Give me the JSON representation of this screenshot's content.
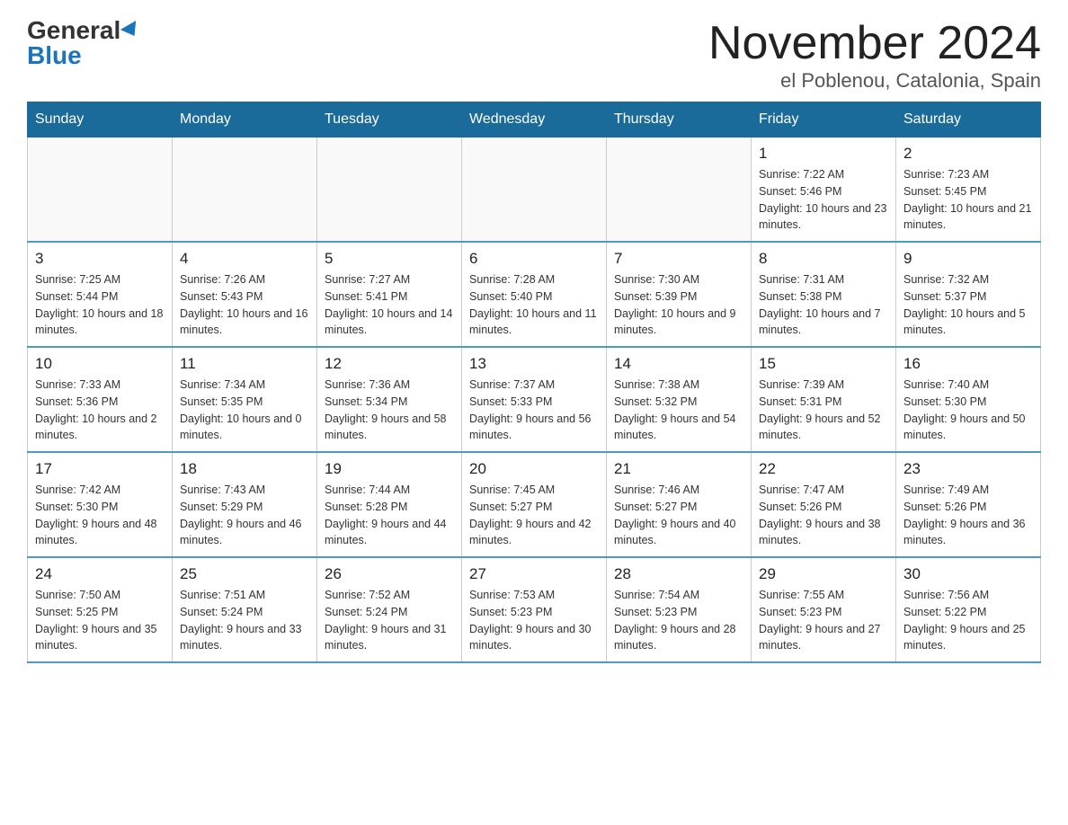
{
  "logo": {
    "general": "General",
    "blue": "Blue"
  },
  "title": "November 2024",
  "subtitle": "el Poblenou, Catalonia, Spain",
  "days_of_week": [
    "Sunday",
    "Monday",
    "Tuesday",
    "Wednesday",
    "Thursday",
    "Friday",
    "Saturday"
  ],
  "weeks": [
    [
      {
        "day": "",
        "info": ""
      },
      {
        "day": "",
        "info": ""
      },
      {
        "day": "",
        "info": ""
      },
      {
        "day": "",
        "info": ""
      },
      {
        "day": "",
        "info": ""
      },
      {
        "day": "1",
        "info": "Sunrise: 7:22 AM\nSunset: 5:46 PM\nDaylight: 10 hours and 23 minutes."
      },
      {
        "day": "2",
        "info": "Sunrise: 7:23 AM\nSunset: 5:45 PM\nDaylight: 10 hours and 21 minutes."
      }
    ],
    [
      {
        "day": "3",
        "info": "Sunrise: 7:25 AM\nSunset: 5:44 PM\nDaylight: 10 hours and 18 minutes."
      },
      {
        "day": "4",
        "info": "Sunrise: 7:26 AM\nSunset: 5:43 PM\nDaylight: 10 hours and 16 minutes."
      },
      {
        "day": "5",
        "info": "Sunrise: 7:27 AM\nSunset: 5:41 PM\nDaylight: 10 hours and 14 minutes."
      },
      {
        "day": "6",
        "info": "Sunrise: 7:28 AM\nSunset: 5:40 PM\nDaylight: 10 hours and 11 minutes."
      },
      {
        "day": "7",
        "info": "Sunrise: 7:30 AM\nSunset: 5:39 PM\nDaylight: 10 hours and 9 minutes."
      },
      {
        "day": "8",
        "info": "Sunrise: 7:31 AM\nSunset: 5:38 PM\nDaylight: 10 hours and 7 minutes."
      },
      {
        "day": "9",
        "info": "Sunrise: 7:32 AM\nSunset: 5:37 PM\nDaylight: 10 hours and 5 minutes."
      }
    ],
    [
      {
        "day": "10",
        "info": "Sunrise: 7:33 AM\nSunset: 5:36 PM\nDaylight: 10 hours and 2 minutes."
      },
      {
        "day": "11",
        "info": "Sunrise: 7:34 AM\nSunset: 5:35 PM\nDaylight: 10 hours and 0 minutes."
      },
      {
        "day": "12",
        "info": "Sunrise: 7:36 AM\nSunset: 5:34 PM\nDaylight: 9 hours and 58 minutes."
      },
      {
        "day": "13",
        "info": "Sunrise: 7:37 AM\nSunset: 5:33 PM\nDaylight: 9 hours and 56 minutes."
      },
      {
        "day": "14",
        "info": "Sunrise: 7:38 AM\nSunset: 5:32 PM\nDaylight: 9 hours and 54 minutes."
      },
      {
        "day": "15",
        "info": "Sunrise: 7:39 AM\nSunset: 5:31 PM\nDaylight: 9 hours and 52 minutes."
      },
      {
        "day": "16",
        "info": "Sunrise: 7:40 AM\nSunset: 5:30 PM\nDaylight: 9 hours and 50 minutes."
      }
    ],
    [
      {
        "day": "17",
        "info": "Sunrise: 7:42 AM\nSunset: 5:30 PM\nDaylight: 9 hours and 48 minutes."
      },
      {
        "day": "18",
        "info": "Sunrise: 7:43 AM\nSunset: 5:29 PM\nDaylight: 9 hours and 46 minutes."
      },
      {
        "day": "19",
        "info": "Sunrise: 7:44 AM\nSunset: 5:28 PM\nDaylight: 9 hours and 44 minutes."
      },
      {
        "day": "20",
        "info": "Sunrise: 7:45 AM\nSunset: 5:27 PM\nDaylight: 9 hours and 42 minutes."
      },
      {
        "day": "21",
        "info": "Sunrise: 7:46 AM\nSunset: 5:27 PM\nDaylight: 9 hours and 40 minutes."
      },
      {
        "day": "22",
        "info": "Sunrise: 7:47 AM\nSunset: 5:26 PM\nDaylight: 9 hours and 38 minutes."
      },
      {
        "day": "23",
        "info": "Sunrise: 7:49 AM\nSunset: 5:26 PM\nDaylight: 9 hours and 36 minutes."
      }
    ],
    [
      {
        "day": "24",
        "info": "Sunrise: 7:50 AM\nSunset: 5:25 PM\nDaylight: 9 hours and 35 minutes."
      },
      {
        "day": "25",
        "info": "Sunrise: 7:51 AM\nSunset: 5:24 PM\nDaylight: 9 hours and 33 minutes."
      },
      {
        "day": "26",
        "info": "Sunrise: 7:52 AM\nSunset: 5:24 PM\nDaylight: 9 hours and 31 minutes."
      },
      {
        "day": "27",
        "info": "Sunrise: 7:53 AM\nSunset: 5:23 PM\nDaylight: 9 hours and 30 minutes."
      },
      {
        "day": "28",
        "info": "Sunrise: 7:54 AM\nSunset: 5:23 PM\nDaylight: 9 hours and 28 minutes."
      },
      {
        "day": "29",
        "info": "Sunrise: 7:55 AM\nSunset: 5:23 PM\nDaylight: 9 hours and 27 minutes."
      },
      {
        "day": "30",
        "info": "Sunrise: 7:56 AM\nSunset: 5:22 PM\nDaylight: 9 hours and 25 minutes."
      }
    ]
  ]
}
